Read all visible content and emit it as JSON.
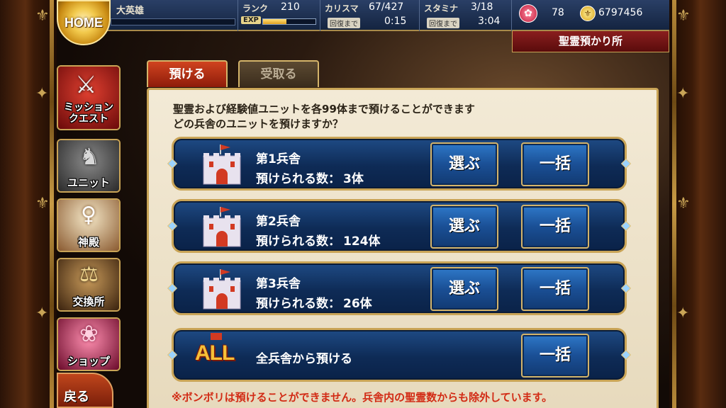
{
  "header": {
    "home_label": "HOME",
    "player_name": "大英雄",
    "rank_label": "ランク",
    "rank_value": "210",
    "exp_label": "EXP",
    "exp_progress": 0.45,
    "charisma_label": "カリスマ",
    "charisma_value": "67/427",
    "charisma_recover_label": "回復まで",
    "charisma_recover_time": "0:15",
    "stamina_label": "スタミナ",
    "stamina_value": "3/18",
    "stamina_recover_label": "回復まで",
    "stamina_recover_time": "3:04",
    "crystal_count": "78",
    "gold_count": "6797456"
  },
  "page": {
    "title": "聖霊預かり所"
  },
  "tabs": [
    {
      "label": "預ける",
      "active": true
    },
    {
      "label": "受取る",
      "active": false
    }
  ],
  "sidebar": [
    {
      "label": "ミッション\nクエスト",
      "icon": "crossed-swords-icon"
    },
    {
      "label": "ユニット",
      "icon": "knight-icon"
    },
    {
      "label": "神殿",
      "icon": "goddess-icon"
    },
    {
      "label": "交換所",
      "icon": "scales-icon"
    },
    {
      "label": "ショップ",
      "icon": "crystal-icon"
    }
  ],
  "back_label": "戻る",
  "instructions": {
    "line1": "聖霊および経験値ユニットを各99体まで預けることができます",
    "line2": "どの兵舎のユニットを預けますか？"
  },
  "barracks": [
    {
      "name": "第1兵舎",
      "count_label": "預けられる数：",
      "count": "3体",
      "select_label": "選ぶ",
      "bulk_label": "一括"
    },
    {
      "name": "第2兵舎",
      "count_label": "預けられる数：",
      "count": "124体",
      "select_label": "選ぶ",
      "bulk_label": "一括"
    },
    {
      "name": "第3兵舎",
      "count_label": "預けられる数：",
      "count": "26体",
      "select_label": "選ぶ",
      "bulk_label": "一括"
    }
  ],
  "all_row": {
    "logo": "ALL",
    "name": "全兵舎から預ける",
    "bulk_label": "一括"
  },
  "note": "※ボンボリは預けることができません。兵舎内の聖霊数からも除外しています。",
  "colors": {
    "accent_gold": "#c9a456",
    "row_blue": "#0e2b56",
    "active_tab_red": "#d0431f",
    "note_red": "#d22a14"
  }
}
